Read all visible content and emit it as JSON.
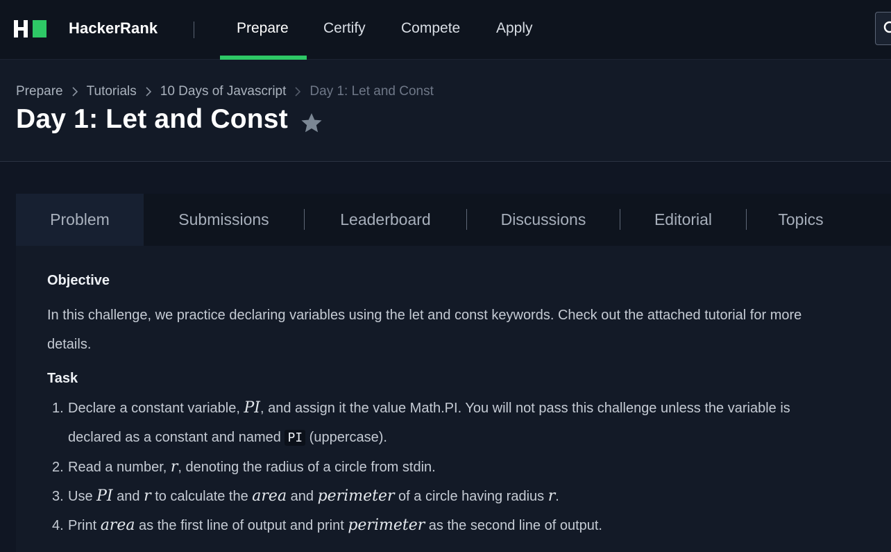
{
  "nav": {
    "brand": "HackerRank",
    "links": [
      "Prepare",
      "Certify",
      "Compete",
      "Apply"
    ],
    "active_link": "Prepare",
    "accent_color": "#2ec866",
    "logo_icon": "hackerrank-logo-icon",
    "search_icon": "search-icon"
  },
  "breadcrumb": [
    "Prepare",
    "Tutorials",
    "10 Days of Javascript",
    "Day 1: Let and Const"
  ],
  "page": {
    "title": "Day 1: Let and Const",
    "bookmark_icon": "star-icon"
  },
  "tabs": [
    "Problem",
    "Submissions",
    "Leaderboard",
    "Discussions",
    "Editorial",
    "Topics"
  ],
  "active_tab": "Problem",
  "problem": {
    "objective_heading": "Objective",
    "objective_text_line1": "In this challenge, we practice declaring variables using the let and const keywords. Check out the attached tutorial for more",
    "objective_text_line2": "details.",
    "task_heading": "Task",
    "tasks": [
      {
        "num": "1.",
        "p1": "Declare a constant variable, ",
        "m1": "PI",
        "p2": ", and assign it the value Math.PI. You will not pass this challenge unless the variable is",
        "p3": "declared as a constant and named ",
        "code": "PI",
        "p4": " (uppercase)."
      },
      {
        "num": "2.",
        "p1": "Read a number, ",
        "m1": "r",
        "p2": ", denoting the radius of a circle from stdin."
      },
      {
        "num": "3.",
        "p1": "Use ",
        "m1": "PI",
        "p2": " and ",
        "m2": "r",
        "p3": " to calculate the ",
        "m3": "area",
        "p4": " and ",
        "m4": "perimeter",
        "p5": " of a circle having radius ",
        "m5": "r",
        "p6": "."
      },
      {
        "num": "4.",
        "p1": "Print ",
        "m1": "area",
        "p2": " as the first line of output and print ",
        "m2": "perimeter",
        "p3": " as the second line of output."
      }
    ]
  }
}
